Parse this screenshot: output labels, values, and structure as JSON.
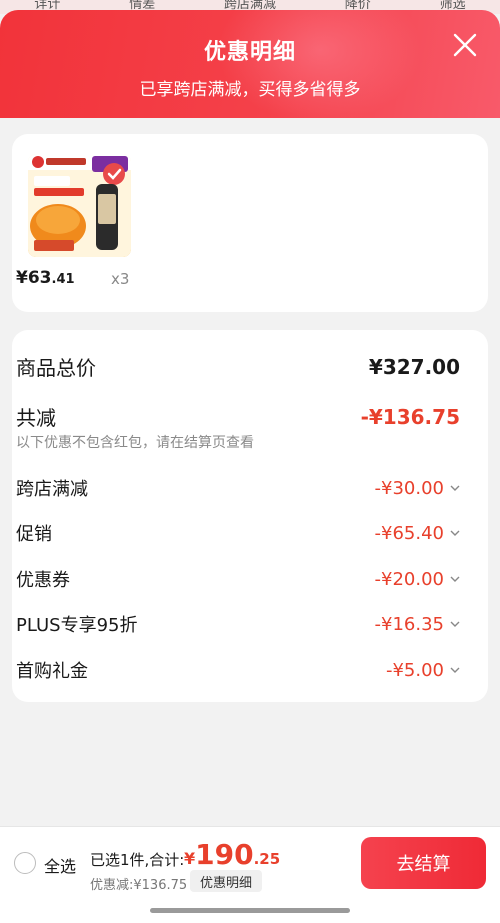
{
  "underlying_nav": [
    "详计",
    "情差",
    "跨店满减",
    "降价",
    "筛选"
  ],
  "header": {
    "title": "优惠明细",
    "subtitle": "已享跨店满减，买得多省得多"
  },
  "product": {
    "price_int": "¥63",
    "price_dec": ".41",
    "quantity": "x3"
  },
  "details": {
    "total_label": "商品总价",
    "total_value": "¥327.00",
    "discount_label": "共减",
    "discount_value": "-¥136.75",
    "note": "以下优惠不包含红包，请在结算页查看",
    "items": [
      {
        "label": "跨店满减",
        "value": "-¥30.00"
      },
      {
        "label": "促销",
        "value": "-¥65.40"
      },
      {
        "label": "优惠券",
        "value": "-¥20.00"
      },
      {
        "label": "PLUS专享95折",
        "value": "-¥16.35"
      },
      {
        "label": "首购礼金",
        "value": "-¥5.00"
      }
    ]
  },
  "bottom": {
    "select_all": "全选",
    "selected_text": "已选1件,合计:",
    "total_symbol": "¥",
    "total_int": "190",
    "total_dec": ".25",
    "saving": "优惠减:¥136.75",
    "detail_tag": "优惠明细",
    "checkout": "去结算"
  },
  "colors": {
    "accent_red": "#e8402c",
    "header_red": "#f2333a"
  },
  "icons": {
    "close": "close-icon",
    "chevron": "chevron-down-icon",
    "radio": "radio-unchecked-icon"
  }
}
